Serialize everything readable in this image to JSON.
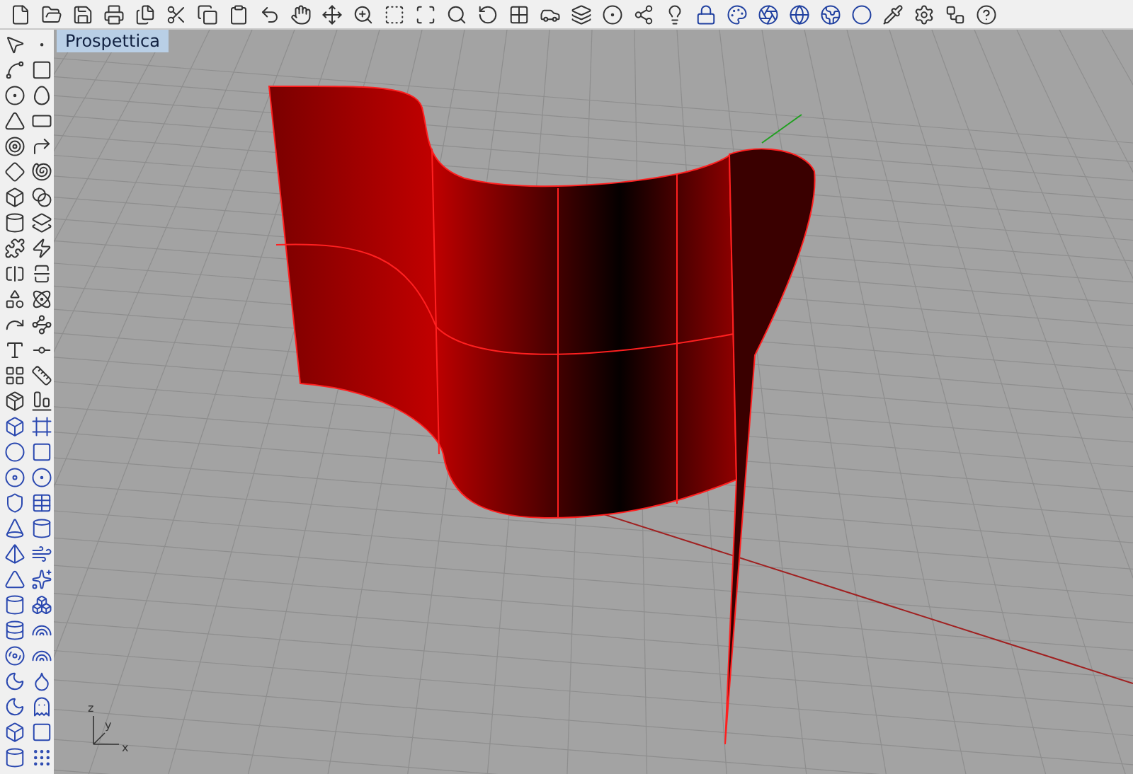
{
  "viewport": {
    "title": "Prospettica",
    "axis_labels": [
      "x",
      "y",
      "z"
    ]
  }
}
